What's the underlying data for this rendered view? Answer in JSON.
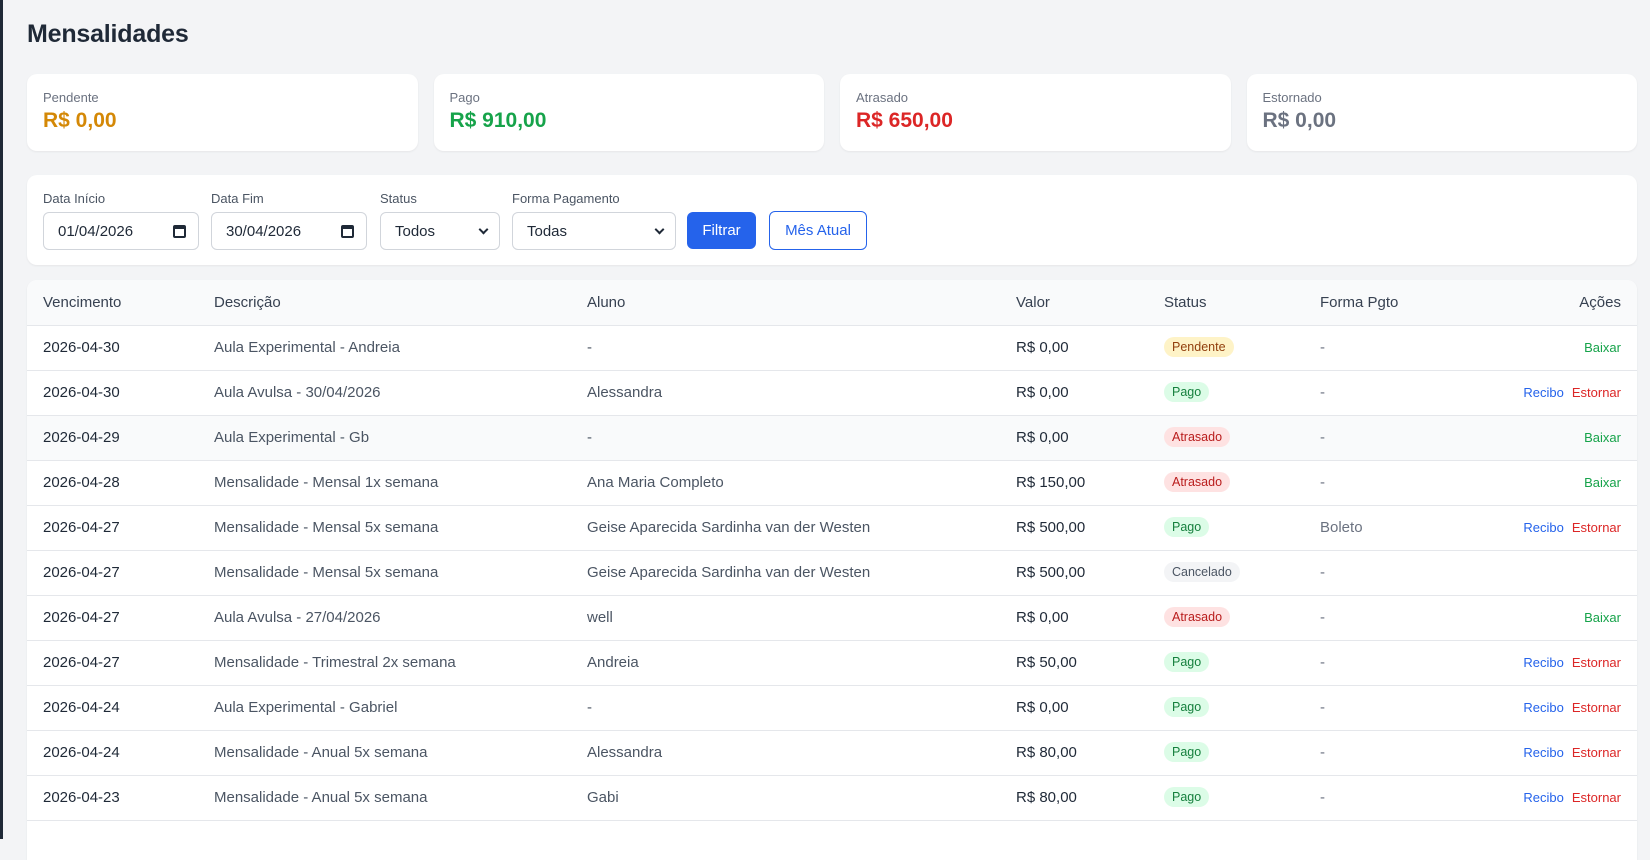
{
  "page": {
    "title": "Mensalidades"
  },
  "cards": [
    {
      "label": "Pendente",
      "value": "R$ 0,00",
      "color": "#d48806"
    },
    {
      "label": "Pago",
      "value": "R$ 910,00",
      "color": "#16a34a"
    },
    {
      "label": "Atrasado",
      "value": "R$ 650,00",
      "color": "#dc2626"
    },
    {
      "label": "Estornado",
      "value": "R$ 0,00",
      "color": "#6b7280"
    }
  ],
  "filters": {
    "data_inicio": {
      "label": "Data Início",
      "value": "01/04/2026"
    },
    "data_fim": {
      "label": "Data Fim",
      "value": "30/04/2026"
    },
    "status": {
      "label": "Status",
      "value": "Todos"
    },
    "forma": {
      "label": "Forma Pagamento",
      "value": "Todas"
    },
    "filtrar_label": "Filtrar",
    "mes_atual_label": "Mês Atual"
  },
  "table": {
    "headers": {
      "vencimento": "Vencimento",
      "descricao": "Descrição",
      "aluno": "Aluno",
      "valor": "Valor",
      "status": "Status",
      "forma": "Forma Pgto",
      "acoes": "Ações"
    },
    "action_labels": {
      "recibo": "Recibo",
      "estornar": "Estornar",
      "baixar": "Baixar"
    },
    "rows": [
      {
        "venc": "2026-04-30",
        "desc": "Aula Experimental - Andreia",
        "aluno": "-",
        "valor": "R$ 0,00",
        "status": "Pendente",
        "forma": "-"
      },
      {
        "venc": "2026-04-30",
        "desc": "Aula Avulsa - 30/04/2026",
        "aluno": "Alessandra",
        "valor": "R$ 0,00",
        "status": "Pago",
        "forma": "-"
      },
      {
        "venc": "2026-04-29",
        "desc": "Aula Experimental - Gb",
        "aluno": "-",
        "valor": "R$ 0,00",
        "status": "Atrasado",
        "forma": "-"
      },
      {
        "venc": "2026-04-28",
        "desc": "Mensalidade - Mensal 1x semana",
        "aluno": "Ana Maria Completo",
        "valor": "R$ 150,00",
        "status": "Atrasado",
        "forma": "-"
      },
      {
        "venc": "2026-04-27",
        "desc": "Mensalidade - Mensal 5x semana",
        "aluno": "Geise Aparecida Sardinha van der Westen",
        "valor": "R$ 500,00",
        "status": "Pago",
        "forma": "Boleto"
      },
      {
        "venc": "2026-04-27",
        "desc": "Mensalidade - Mensal 5x semana",
        "aluno": "Geise Aparecida Sardinha van der Westen",
        "valor": "R$ 500,00",
        "status": "Cancelado",
        "forma": "-"
      },
      {
        "venc": "2026-04-27",
        "desc": "Aula Avulsa - 27/04/2026",
        "aluno": "well",
        "valor": "R$ 0,00",
        "status": "Atrasado",
        "forma": "-"
      },
      {
        "venc": "2026-04-27",
        "desc": "Mensalidade - Trimestral 2x semana",
        "aluno": "Andreia",
        "valor": "R$ 50,00",
        "status": "Pago",
        "forma": "-"
      },
      {
        "venc": "2026-04-24",
        "desc": "Aula Experimental - Gabriel",
        "aluno": "-",
        "valor": "R$ 0,00",
        "status": "Pago",
        "forma": "-"
      },
      {
        "venc": "2026-04-24",
        "desc": "Mensalidade - Anual 5x semana",
        "aluno": "Alessandra",
        "valor": "R$ 80,00",
        "status": "Pago",
        "forma": "-"
      },
      {
        "venc": "2026-04-23",
        "desc": "Mensalidade - Anual 5x semana",
        "aluno": "Gabi",
        "valor": "R$ 80,00",
        "status": "Pago",
        "forma": "-"
      }
    ]
  }
}
